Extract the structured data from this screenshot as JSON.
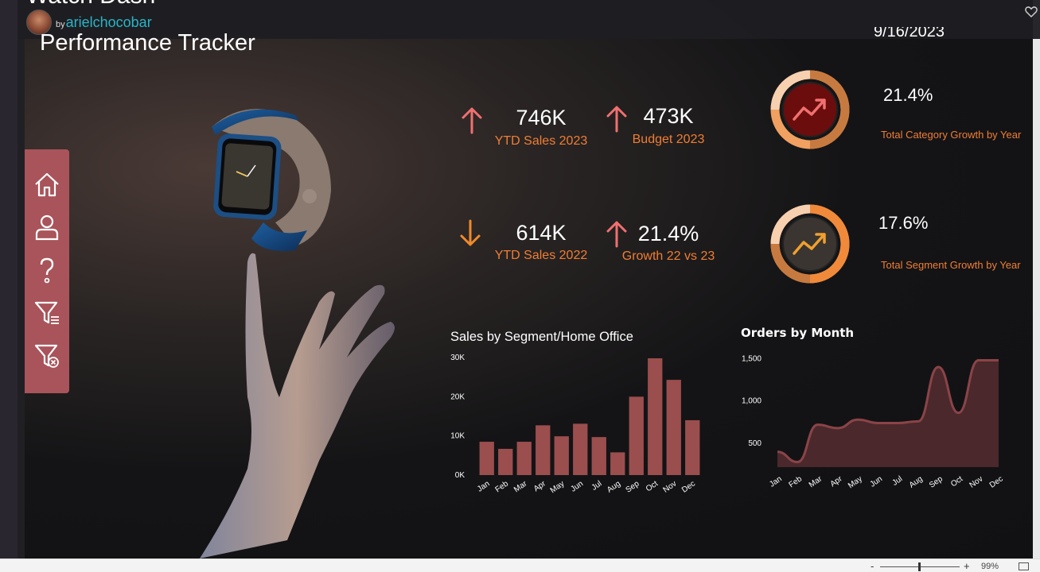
{
  "app": {
    "title": "Watch Dash",
    "author_prefix": "by",
    "author": "arielchocobar"
  },
  "page": {
    "title": "Performance Tracker",
    "date": "9/16/2023"
  },
  "nav": [
    {
      "icon": "home-icon"
    },
    {
      "icon": "user-icon"
    },
    {
      "icon": "help-icon"
    },
    {
      "icon": "filter-icon"
    },
    {
      "icon": "clear-filter-icon"
    }
  ],
  "kpis": [
    {
      "value": "746K",
      "label": "YTD Sales 2023",
      "direction": "up",
      "color": "#f07070"
    },
    {
      "value": "473K",
      "label": "Budget 2023",
      "direction": "up",
      "color": "#f07070"
    },
    {
      "value": "614K",
      "label": "YTD Sales 2022",
      "direction": "down",
      "color": "#f08a2a"
    },
    {
      "value": "21.4%",
      "label": "Growth 22 vs 23",
      "direction": "up",
      "color": "#f07070"
    }
  ],
  "rings": [
    {
      "value": "21.4%",
      "label": "Total Category Growth by Year",
      "inner_color": "#6b0d0d",
      "icon_color": "#f07070"
    },
    {
      "value": "17.6%",
      "label": "Total Segment Growth by Year",
      "inner_color": "#3a3530",
      "icon_color": "#f0a030"
    }
  ],
  "charts": {
    "bar_title": "Sales by Segment/Home Office",
    "line_title": "Orders by Month"
  },
  "chart_data": [
    {
      "type": "bar",
      "title": "Sales by Segment/Home Office",
      "categories": [
        "Jan",
        "Feb",
        "Mar",
        "Apr",
        "May",
        "Jun",
        "Jul",
        "Aug",
        "Sep",
        "Oct",
        "Nov",
        "Dec"
      ],
      "values": [
        8500,
        6700,
        8500,
        12700,
        9900,
        13100,
        9700,
        5800,
        20000,
        29800,
        24300,
        14000
      ],
      "y_ticks": [
        "0K",
        "10K",
        "20K",
        "30K"
      ],
      "ylim": [
        0,
        30000
      ],
      "color": "#9b4e4e"
    },
    {
      "type": "area",
      "title": "Orders by Month",
      "categories": [
        "Jan",
        "Feb",
        "Mar",
        "Apr",
        "May",
        "Jun",
        "Jul",
        "Aug",
        "Sep",
        "Oct",
        "Nov",
        "Dec"
      ],
      "values": [
        400,
        280,
        720,
        680,
        780,
        740,
        740,
        760,
        1400,
        860,
        1480,
        1480
      ],
      "y_ticks": [
        "500",
        "1,000",
        "1,500"
      ],
      "ylim": [
        220,
        1550
      ],
      "color": "#7a3a3e"
    }
  ],
  "statusbar": {
    "zoom_minus": "-",
    "zoom_plus": "+",
    "zoom": "99%",
    "zoom_fraction": 0.49
  },
  "colors": {
    "accent": "#f07e34",
    "nav_bg": "#a9545a",
    "author": "#28b5c8"
  }
}
